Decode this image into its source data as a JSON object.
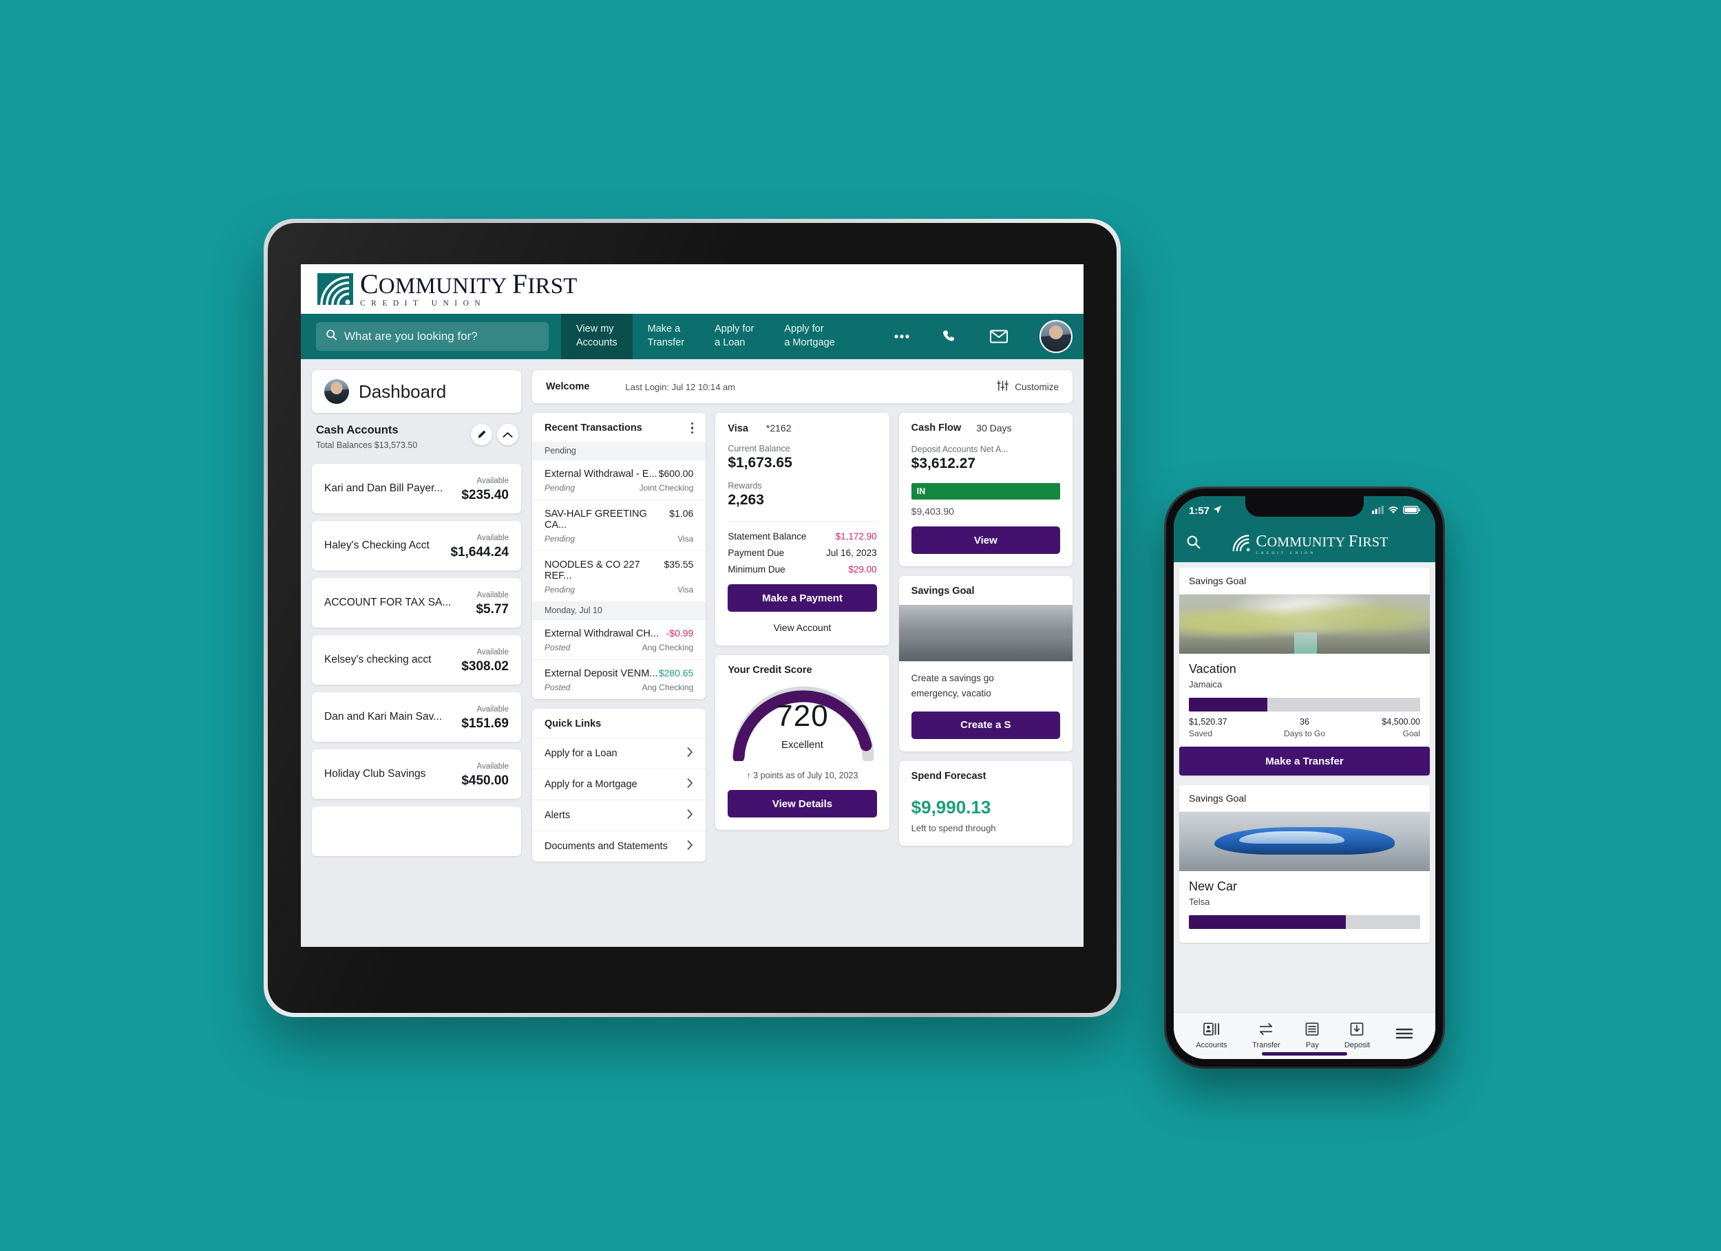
{
  "brand": {
    "name_part1": "C",
    "name_rest1": "OMMUNITY",
    "name_part2": "F",
    "name_rest2": "IRST",
    "tagline": "CREDIT UNION",
    "teal": "#0c6f6d",
    "purple": "#43126e",
    "green": "#1a9f7a",
    "red": "#d3265c"
  },
  "tablet": {
    "search": {
      "placeholder": "What are you looking for?",
      "icon": "search-icon"
    },
    "nav": [
      {
        "line1": "View my",
        "line2": "Accounts",
        "active": true
      },
      {
        "line1": "Make a",
        "line2": "Transfer",
        "active": false
      },
      {
        "line1": "Apply for",
        "line2": "a Loan",
        "active": false
      },
      {
        "line1": "Apply for",
        "line2": "a Mortgage",
        "active": false
      }
    ],
    "nav_icons": [
      "more-icon",
      "phone-icon",
      "mail-icon",
      "avatar"
    ],
    "sidebar": {
      "dashboard_label": "Dashboard",
      "group_title": "Cash Accounts",
      "group_total": "Total Balances $13,573.50",
      "edit_icon": "pencil-icon",
      "collapse_icon": "chevron-up-icon",
      "available_label": "Available",
      "accounts": [
        {
          "name": "Kari and Dan Bill Payer...",
          "balance": "$235.40"
        },
        {
          "name": "Haley's Checking Acct",
          "balance": "$1,644.24"
        },
        {
          "name": "ACCOUNT FOR TAX SA...",
          "balance": "$5.77"
        },
        {
          "name": "Kelsey's checking acct",
          "balance": "$308.02"
        },
        {
          "name": "Dan and Kari Main Sav...",
          "balance": "$151.69"
        },
        {
          "name": "Holiday Club Savings",
          "balance": "$450.00"
        }
      ]
    },
    "welcome": {
      "title": "Welcome",
      "last_login": "Last Login: Jul 12 10:14 am",
      "customize": "Customize",
      "customize_icon": "sliders-icon"
    },
    "recent_transactions": {
      "title": "Recent Transactions",
      "menu_icon": "kebab-menu-icon",
      "groups": [
        {
          "label": "Pending",
          "items": [
            {
              "desc": "External Withdrawal - E...",
              "amount": "$600.00",
              "tone": "",
              "status": "Pending",
              "account": "Joint Checking"
            },
            {
              "desc": "SAV-HALF GREETING CA...",
              "amount": "$1.06",
              "tone": "",
              "status": "Pending",
              "account": "Visa"
            },
            {
              "desc": "NOODLES & CO 227 REF...",
              "amount": "$35.55",
              "tone": "",
              "status": "Pending",
              "account": "Visa"
            }
          ]
        },
        {
          "label": "Monday, Jul 10",
          "items": [
            {
              "desc": "External Withdrawal CH...",
              "amount": "-$0.99",
              "tone": "neg",
              "status": "Posted",
              "account": "Ang Checking"
            },
            {
              "desc": "External Deposit VENM...",
              "amount": "$280.65",
              "tone": "pos",
              "status": "Posted",
              "account": "Ang Checking"
            }
          ]
        }
      ]
    },
    "quick_links": {
      "title": "Quick Links",
      "chevron_icon": "chevron-right-icon",
      "items": [
        "Apply for a Loan",
        "Apply for a Mortgage",
        "Alerts",
        "Documents and Statements"
      ]
    },
    "visa": {
      "title": "Visa",
      "number": "*2162",
      "current_balance_label": "Current Balance",
      "current_balance": "$1,673.65",
      "rewards_label": "Rewards",
      "rewards": "2,263",
      "statement_balance_label": "Statement Balance",
      "statement_balance": "$1,172.90",
      "payment_due_label": "Payment Due",
      "payment_due": "Jul 16, 2023",
      "minimum_due_label": "Minimum Due",
      "minimum_due": "$29.00",
      "primary_button": "Make a Payment",
      "secondary_link": "View Account"
    },
    "credit_score": {
      "title": "Your Credit Score",
      "score": "720",
      "rating": "Excellent",
      "delta": "↑ 3 points as of July 10, 2023",
      "button": "View Details"
    },
    "cash_flow": {
      "title": "Cash Flow",
      "period": "30 Days",
      "net_label": "Deposit Accounts Net A...",
      "net_value": "$3,612.27",
      "in_label": "IN",
      "in_amount": "$9,403.90",
      "button": "View"
    },
    "savings_goal": {
      "title": "Savings Goal",
      "text_line1": "Create a savings go",
      "text_line2": "emergency, vacatio",
      "button": "Create a S"
    },
    "spend_forecast": {
      "title": "Spend Forecast",
      "value": "$9,990.13",
      "sub": "Left to spend through"
    }
  },
  "phone": {
    "status": {
      "time": "1:57",
      "location_icon": "location-arrow-icon",
      "signal_icon": "signal-icon",
      "wifi_icon": "wifi-icon",
      "battery_icon": "battery-icon"
    },
    "search_icon": "search-icon",
    "cards": [
      {
        "header": "Savings Goal",
        "hero": "hero-jamaica",
        "title": "Vacation",
        "subtitle": "Jamaica",
        "progress_pct": 34,
        "saved": "$1,520.37",
        "saved_label": "Saved",
        "days": "36",
        "days_label": "Days to Go",
        "goal": "$4,500.00",
        "goal_label": "Goal",
        "button": "Make a Transfer"
      },
      {
        "header": "Savings Goal",
        "hero": "hero-car",
        "title": "New Car",
        "subtitle": "Telsa",
        "progress_pct": 68,
        "saved": "",
        "saved_label": "",
        "days": "",
        "days_label": "",
        "goal": "",
        "goal_label": "",
        "button": ""
      }
    ],
    "tabs": [
      {
        "label": "Accounts",
        "icon": "accounts-icon"
      },
      {
        "label": "Transfer",
        "icon": "transfer-icon"
      },
      {
        "label": "Pay",
        "icon": "pay-icon"
      },
      {
        "label": "Deposit",
        "icon": "deposit-icon"
      },
      {
        "label": "",
        "icon": "menu-icon"
      }
    ]
  }
}
